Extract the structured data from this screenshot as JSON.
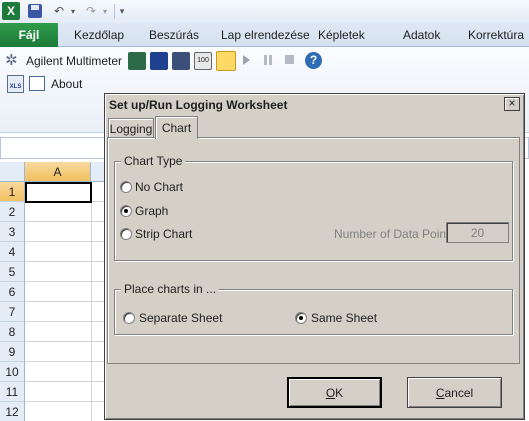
{
  "excel": {
    "logo_text": "X",
    "tabs": [
      {
        "label": "Fájl"
      },
      {
        "label": "Kezdőlap"
      },
      {
        "label": "Beszúrás"
      },
      {
        "label": "Lap elrendezése"
      },
      {
        "label": "Képletek"
      },
      {
        "label": "Adatok"
      },
      {
        "label": "Korrektúra"
      }
    ],
    "ribbon": {
      "addin_name": "Agilent Multimeter",
      "about_label": "About",
      "xls_label": "XLS"
    },
    "grid": {
      "column_header": "A",
      "rows": [
        "1",
        "2",
        "3",
        "4",
        "5",
        "6",
        "7",
        "8",
        "9",
        "10",
        "11",
        "12"
      ]
    }
  },
  "dialog": {
    "title": "Set up/Run Logging Worksheet",
    "close_symbol": "×",
    "tabs": {
      "logging": "Logging",
      "chart": "Chart"
    },
    "chart_type": {
      "title": "Chart Type",
      "options": {
        "no_chart": "No Chart",
        "graph": "Graph",
        "strip_chart": "Strip Chart"
      },
      "selected": "Graph"
    },
    "data_points": {
      "label": "Number of Data Points",
      "value": "20"
    },
    "place_charts": {
      "title": "Place charts in ...",
      "options": {
        "separate_sheet": "Separate Sheet",
        "same_sheet": "Same Sheet"
      },
      "selected": "Same Sheet"
    },
    "buttons": {
      "ok_accel": "O",
      "ok_rest": "K",
      "cancel_accel": "C",
      "cancel_rest": "ancel"
    }
  },
  "colors": {
    "excel_green": "#1d7a38",
    "dialog_gray": "#d4d0c8",
    "active_header": "#f1c15f"
  }
}
